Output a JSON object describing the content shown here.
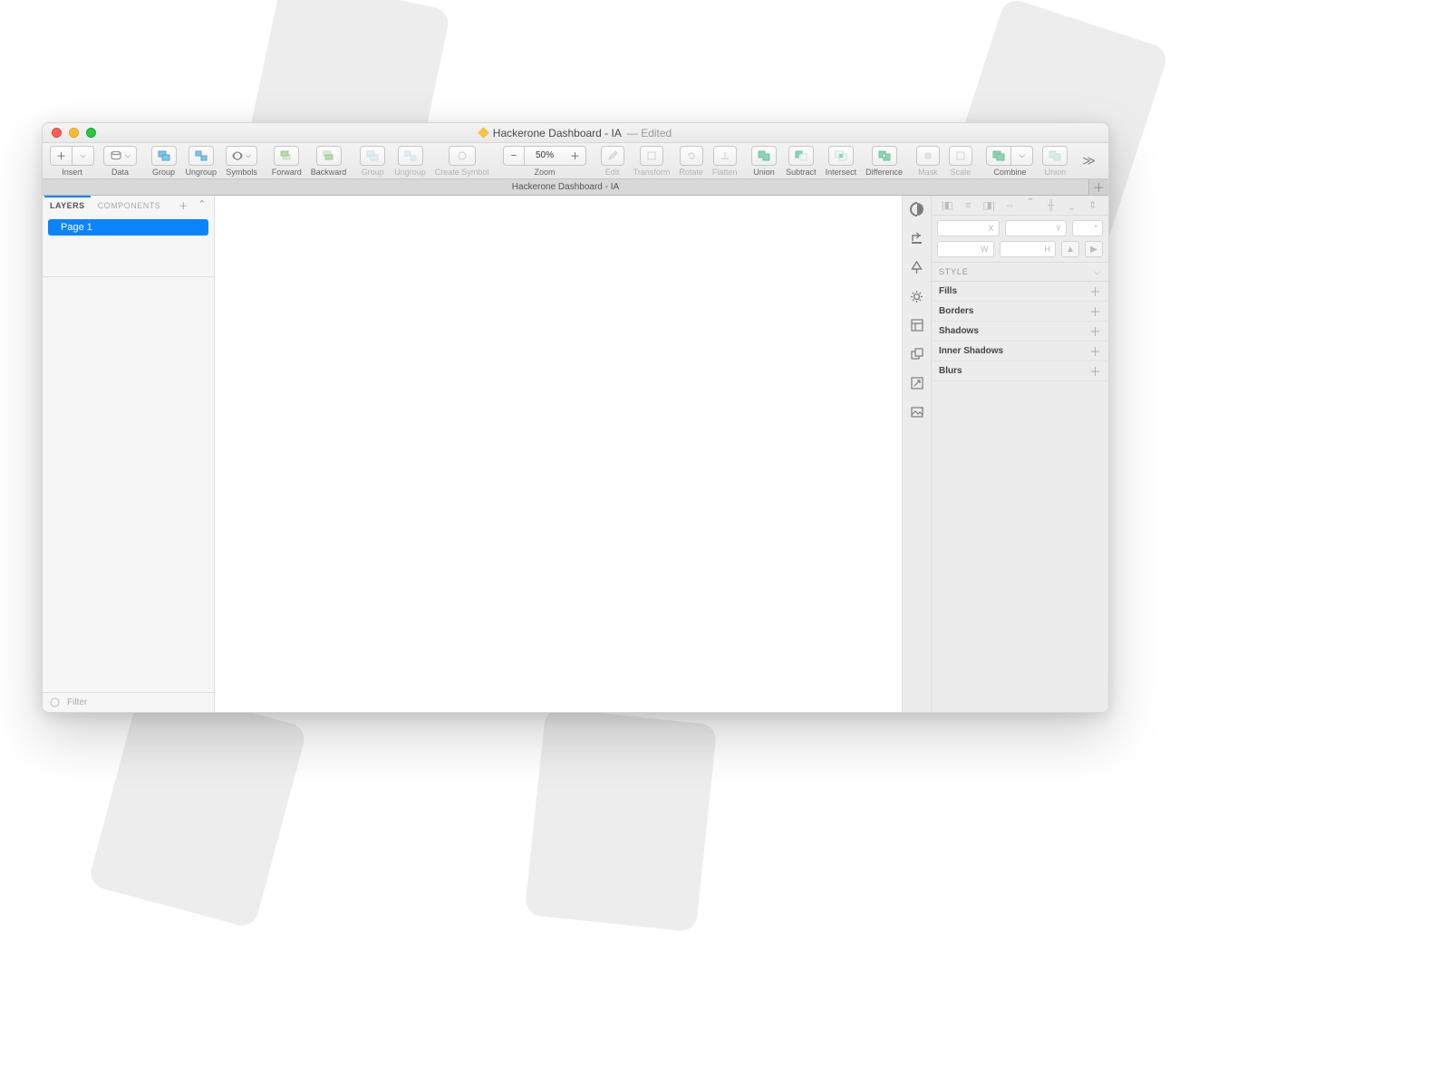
{
  "window": {
    "title": "Hackerone Dashboard - IA",
    "edited_suffix": "— Edited"
  },
  "toolbar": {
    "insert": "Insert",
    "data": "Data",
    "group": "Group",
    "ungroup": "Ungroup",
    "symbols": "Symbols",
    "forward": "Forward",
    "backward": "Backward",
    "group2": "Group",
    "ungroup2": "Ungroup",
    "create_symbol": "Create Symbol",
    "zoom": "Zoom",
    "zoom_value": "50%",
    "edit": "Edit",
    "transform": "Transform",
    "rotate": "Rotate",
    "flatten": "Flatten",
    "union": "Union",
    "subtract": "Subtract",
    "intersect": "Intersect",
    "difference": "Difference",
    "mask": "Mask",
    "scale": "Scale",
    "combine": "Combine",
    "union2": "Union"
  },
  "tabbar": {
    "tab1": "Hackerone Dashboard - IA"
  },
  "left_panel": {
    "tab_layers": "LAYERS",
    "tab_components": "COMPONENTS",
    "page1": "Page 1",
    "filter": "Filter"
  },
  "inspector": {
    "x": "X",
    "y": "Y",
    "w": "W",
    "h": "H",
    "angle": "°",
    "style": "STYLE",
    "fills": "Fills",
    "borders": "Borders",
    "shadows": "Shadows",
    "inner_shadows": "Inner Shadows",
    "blurs": "Blurs"
  }
}
